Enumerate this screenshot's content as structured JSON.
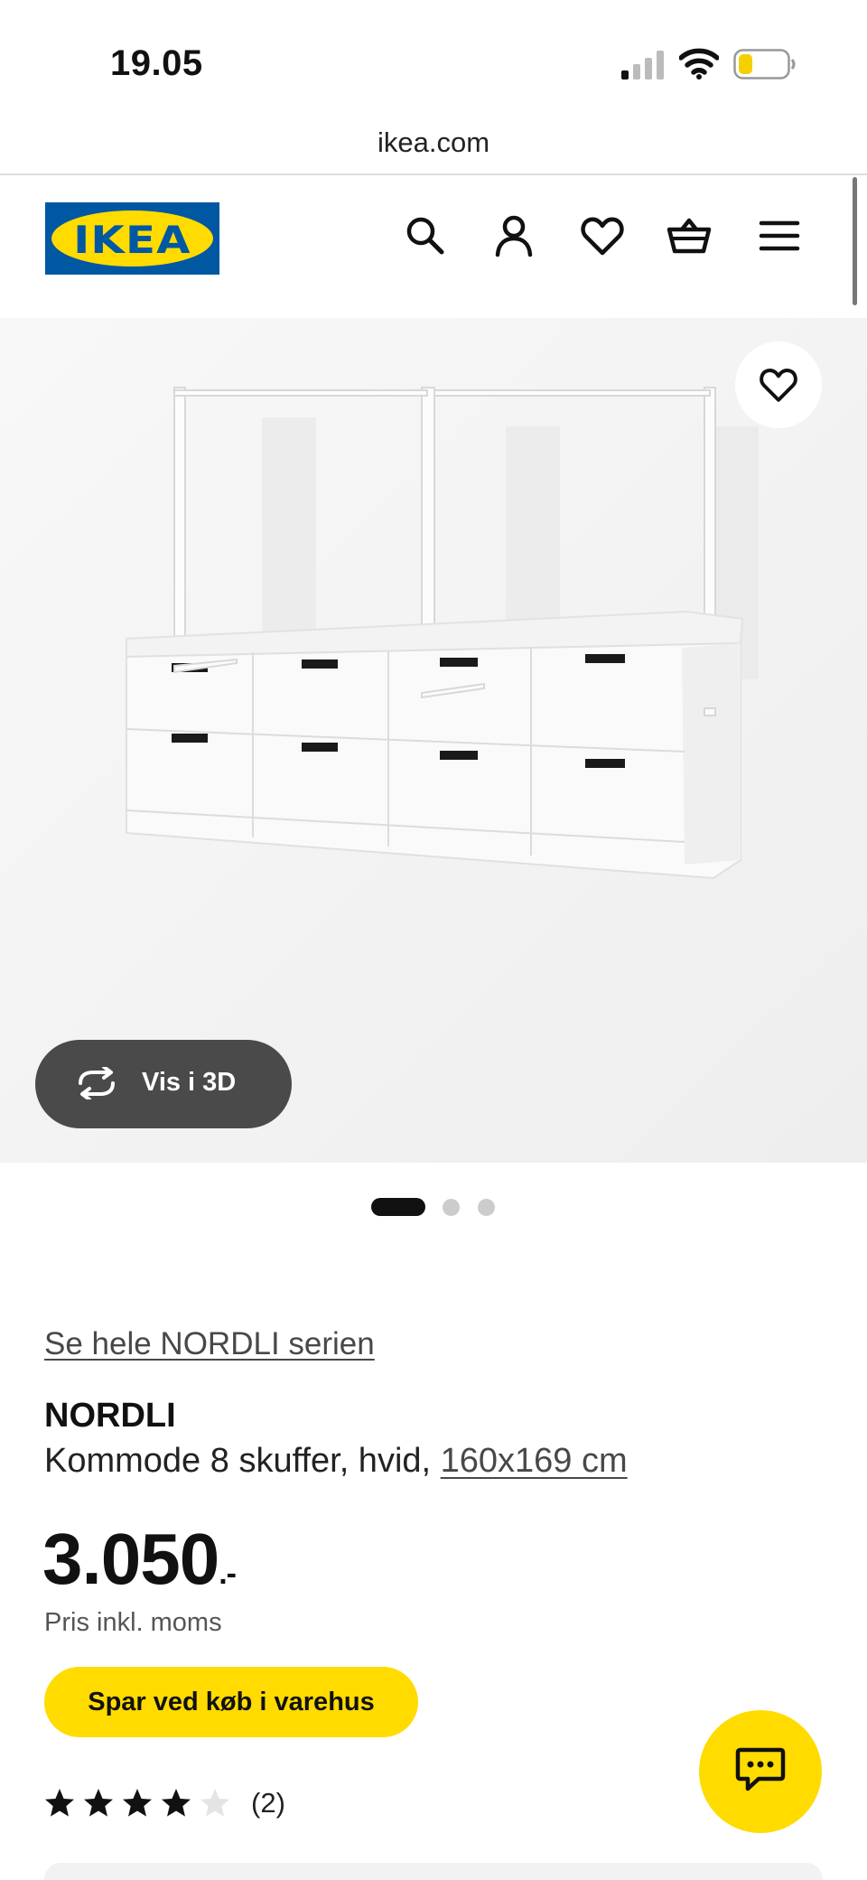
{
  "status_bar": {
    "time": "19.05",
    "battery_level": 0.3,
    "signal_bars": 1
  },
  "browser": {
    "url": "ikea.com"
  },
  "header": {
    "logo_text": "IKEA",
    "icons": [
      "search-icon",
      "account-icon",
      "wishlist-icon",
      "cart-icon",
      "menu-icon"
    ],
    "brand_colors": {
      "blue": "#0058a3",
      "yellow": "#ffdb00"
    }
  },
  "gallery": {
    "view_3d_label": "Vis i 3D",
    "image_count": 3,
    "active_image": 1
  },
  "product": {
    "series_link": "Se hele NORDLI serien",
    "name": "NORDLI",
    "description": "Kommode 8 skuffer, hvid,",
    "dimensions": "160x169 cm",
    "price": "3.050",
    "price_suffix": ".-",
    "price_note": "Pris inkl. moms",
    "store_button": "Spar ved køb i varehus",
    "rating": 4,
    "rating_max": 5,
    "review_count": "(2)"
  },
  "chat": {
    "icon": "chat-icon",
    "color": "#ffdb00"
  }
}
